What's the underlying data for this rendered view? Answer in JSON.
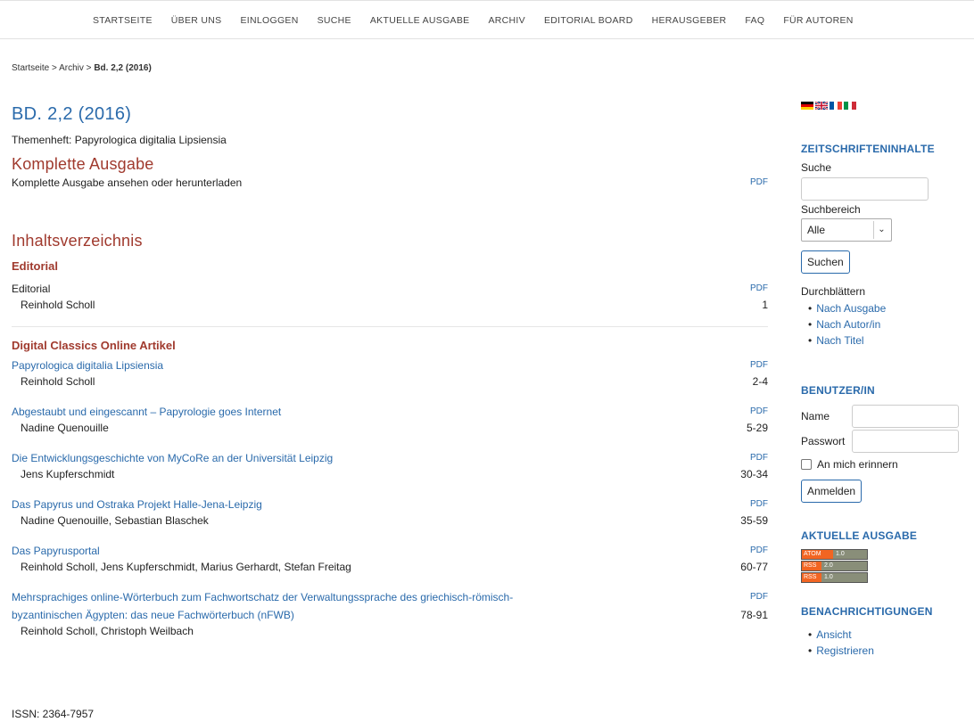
{
  "nav": [
    "STARTSEITE",
    "ÜBER UNS",
    "EINLOGGEN",
    "SUCHE",
    "AKTUELLE AUSGABE",
    "ARCHIV",
    "EDITORIAL BOARD",
    "HERAUSGEBER",
    "FAQ",
    "FÜR AUTOREN"
  ],
  "breadcrumb": {
    "home": "Startseite",
    "sep1": " > ",
    "archive": "Archiv",
    "sep2": " > ",
    "current": "Bd. 2,2 (2016)"
  },
  "issue": {
    "title": "BD. 2,2 (2016)",
    "description": "Themenheft: Papyrologica digitalia Lipsiensia"
  },
  "complete_issue": {
    "heading": "Komplette Ausgabe",
    "text": "Komplette Ausgabe ansehen oder herunterladen",
    "pdf": "PDF"
  },
  "toc": {
    "heading": "Inhaltsverzeichnis",
    "sections": [
      {
        "title": "Editorial",
        "articles": [
          {
            "title": "Editorial",
            "author": "Reinhold Scholl",
            "pages": "1",
            "pdf": "PDF"
          }
        ]
      },
      {
        "title": "Digital Classics Online Artikel",
        "articles": [
          {
            "title": "Papyrologica digitalia Lipsiensia",
            "author": "Reinhold Scholl",
            "pages": "2-4",
            "pdf": "PDF"
          },
          {
            "title": "Abgestaubt und eingescannt – Papyrologie goes Internet",
            "author": "Nadine Quenouille",
            "pages": "5-29",
            "pdf": "PDF"
          },
          {
            "title": "Die Entwicklungsgeschichte von MyCoRe an der Universität Leipzig",
            "author": "Jens Kupferschmidt",
            "pages": "30-34",
            "pdf": "PDF"
          },
          {
            "title": "Das Papyrus und Ostraka Projekt Halle-Jena-Leipzig",
            "author": "Nadine Quenouille, Sebastian Blaschek",
            "pages": "35-59",
            "pdf": "PDF"
          },
          {
            "title": "Das Papyrusportal",
            "author": "Reinhold Scholl, Jens Kupferschmidt, Marius Gerhardt, Stefan Freitag",
            "pages": "60-77",
            "pdf": "PDF"
          },
          {
            "title_line1": "Mehrsprachiges online-Wörterbuch zum Fachwortschatz der Verwaltungssprache des griechisch-römisch-",
            "title_line2": "byzantinischen Ägypten: das neue Fachwörterbuch (nFWB)",
            "author": "Reinhold Scholl, Christoph Weilbach",
            "pages": "78-91",
            "pdf": "PDF"
          }
        ]
      }
    ]
  },
  "footer": {
    "issn": "ISSN: 2364-7957"
  },
  "sidebar": {
    "journal_content": {
      "heading": "ZEITSCHRIFTENINHALTE",
      "search_label": "Suche",
      "scope_label": "Suchbereich",
      "scope_value": "Alle",
      "search_button": "Suchen",
      "browse_label": "Durchblättern",
      "browse": [
        "Nach Ausgabe",
        "Nach Autor/in",
        "Nach Titel"
      ]
    },
    "user": {
      "heading": "BENUTZER/IN",
      "name_label": "Name",
      "password_label": "Passwort",
      "remember_label": "An mich erinnern",
      "login_button": "Anmelden"
    },
    "current_issue": {
      "heading": "AKTUELLE AUSGABE",
      "feeds": [
        {
          "type": "ATOM",
          "version": "1.0"
        },
        {
          "type": "RSS",
          "version": "2.0"
        },
        {
          "type": "RSS",
          "version": "1.0"
        }
      ]
    },
    "notifications": {
      "heading": "BENACHRICHTIGUNGEN",
      "links": [
        "Ansicht",
        "Registrieren"
      ]
    },
    "colors": {
      "accent_blue": "#2a6aab",
      "section_red": "#a03a2e"
    }
  }
}
